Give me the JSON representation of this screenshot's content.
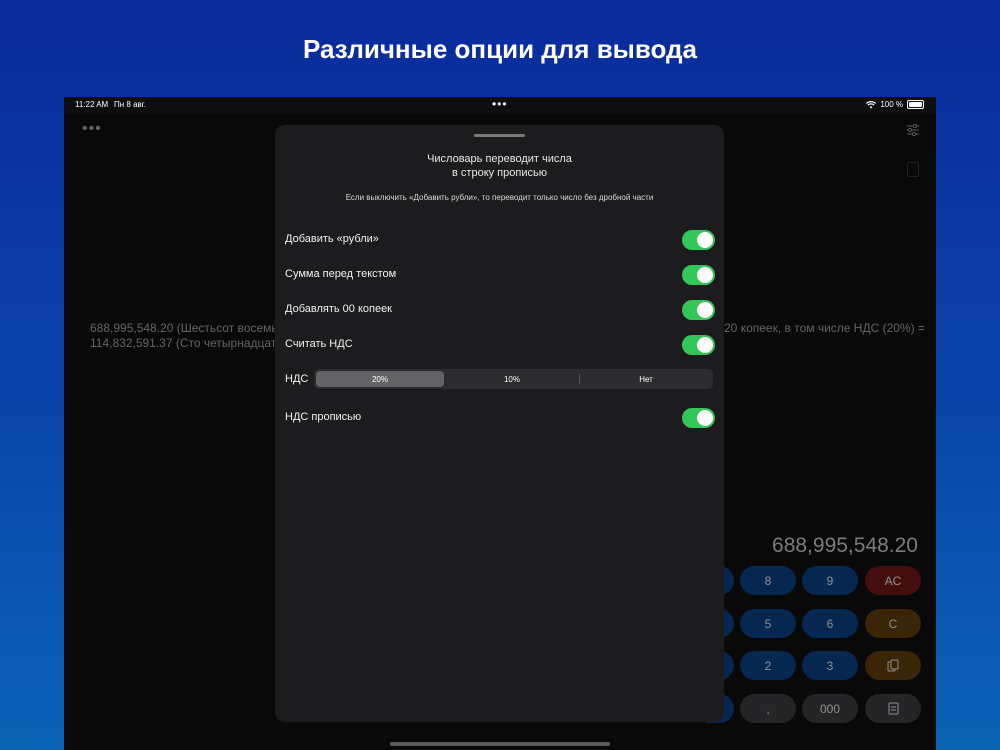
{
  "headline": "Различные опции для вывода",
  "status_bar": {
    "time": "11:22 AM",
    "date": "Пн 8 авг.",
    "battery": "100 %"
  },
  "background": {
    "result_text_line1_left": "688,995,548.20 (Шестьсот восемьде",
    "result_text_line1_right": "20 копеек, в том числе НДС (20%) =",
    "result_text_line2_left": "114,832,591.37 (Сто четырнадцать м",
    "display_value": "688,995,548.20",
    "keys": [
      "8",
      "9",
      "AC",
      "5",
      "6",
      "C",
      "2",
      "3",
      ",",
      "000"
    ]
  },
  "sheet": {
    "title_line1": "Числоварь переводит числа",
    "title_line2": "в строку прописью",
    "note": "Если выключить «Добавить рубли», то переводит только число без дробной части",
    "options": [
      {
        "label": "Добавить «рубли»",
        "on": true
      },
      {
        "label": "Сумма перед текстом",
        "on": true
      },
      {
        "label": "Добавлять 00 копеек",
        "on": true
      },
      {
        "label": "Считать НДС",
        "on": true
      }
    ],
    "vat": {
      "label": "НДС",
      "segments": [
        "20%",
        "10%",
        "Нет"
      ],
      "selected": "20%"
    },
    "vat_words": {
      "label": "НДС прописью",
      "on": true
    }
  },
  "colors": {
    "toggle_on": "#33c759",
    "sheet_bg": "#1c1c1e"
  }
}
